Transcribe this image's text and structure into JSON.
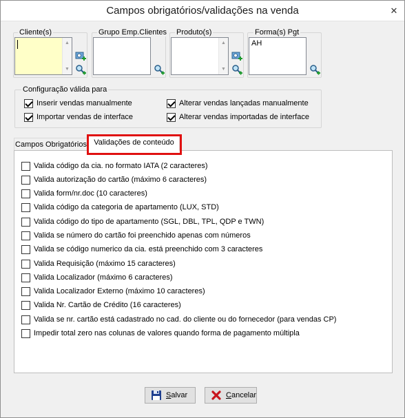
{
  "window": {
    "title": "Campos obrigatórios/validações na venda",
    "close_glyph": "✕"
  },
  "filters": {
    "clientes": {
      "label": "Cliente(s)",
      "value": ""
    },
    "grupo": {
      "label": "Grupo Emp.Clientes"
    },
    "produto": {
      "label": "Produto(s)"
    },
    "forma_pgt": {
      "label": "Forma(s) Pgt",
      "items": [
        "AH"
      ]
    }
  },
  "config": {
    "label": "Configuração válida para",
    "options": [
      {
        "label": "Inserir vendas manualmente",
        "checked": true
      },
      {
        "label": "Importar vendas de interface",
        "checked": true
      },
      {
        "label": "Alterar vendas lançadas manualmente",
        "checked": true
      },
      {
        "label": "Alterar vendas importadas de interface",
        "checked": true
      }
    ]
  },
  "tabs": [
    {
      "label": "Campos Obrigatórios",
      "active": false
    },
    {
      "label": "Validações de conteúdo",
      "active": true
    }
  ],
  "validations": [
    {
      "label": "Valida código da cia. no formato IATA (2 caracteres)",
      "checked": false
    },
    {
      "label": "Valida autorização do cartão (máximo 6 caracteres)",
      "checked": false
    },
    {
      "label": "Valida form/nr.doc (10 caracteres)",
      "checked": false
    },
    {
      "label": "Valida código da categoria de apartamento (LUX, STD)",
      "checked": false
    },
    {
      "label": "Valida código do tipo de apartamento (SGL, DBL, TPL, QDP e TWN)",
      "checked": false
    },
    {
      "label": "Valida se número do cartão foi preenchido apenas com números",
      "checked": false
    },
    {
      "label": "Valida se código numerico da cia. está preenchido com 3 caracteres",
      "checked": false
    },
    {
      "label": "Valida Requisição (máximo 15 caracteres)",
      "checked": false
    },
    {
      "label": "Valida Localizador (máximo 6 caracteres)",
      "checked": false
    },
    {
      "label": "Valida Localizador Externo (máximo 10 caracteres)",
      "checked": false
    },
    {
      "label": "Valida Nr. Cartão de Crédito (16 caracteres)",
      "checked": false
    },
    {
      "label": "Valida se nr. cartão está cadastrado no cad. do cliente ou do fornecedor (para vendas CP)",
      "checked": false
    },
    {
      "label": "Impedir total zero nas colunas de valores quando forma de pagamento múltipla",
      "checked": false
    }
  ],
  "buttons": {
    "salvar": {
      "label_prefix": "",
      "label_underlined": "S",
      "label_rest": "alvar"
    },
    "cancelar": {
      "label_prefix": "",
      "label_underlined": "C",
      "label_rest": "ancelar"
    }
  },
  "colors": {
    "client_list_bg": "#ffffc8",
    "highlight": "#e01010"
  }
}
